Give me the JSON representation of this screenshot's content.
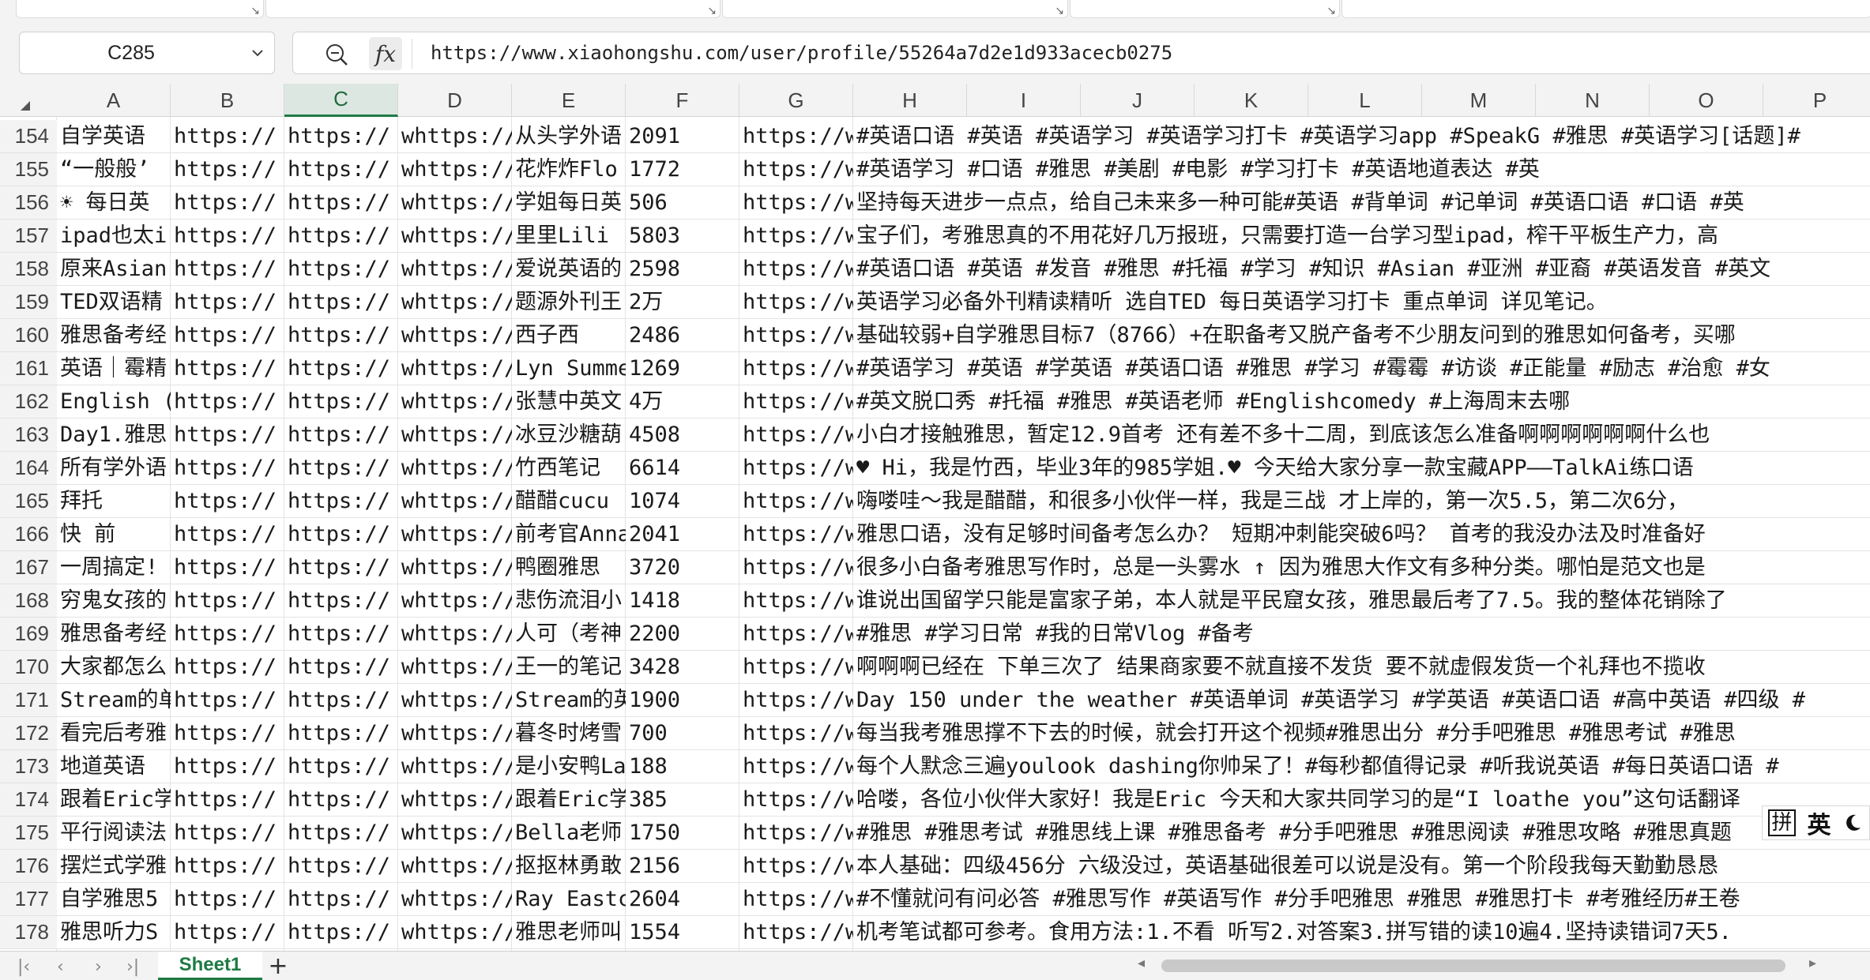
{
  "formula_bar": {
    "name_box": "C285",
    "fx_label": "fx",
    "formula_value": "https://www.xiaohongshu.com/user/profile/55264a7d2e1d933acecb0275"
  },
  "columns": [
    "A",
    "B",
    "C",
    "D",
    "E",
    "F",
    "G",
    "H",
    "I",
    "J",
    "K",
    "L",
    "M",
    "N",
    "O",
    "P"
  ],
  "selected_column": "C",
  "rows": [
    {
      "num": "154",
      "A": "自学英语",
      "B": "https://",
      "C": "https://",
      "D": "whttps://s",
      "E": "从头学外语",
      "F": "2091",
      "G": "https://w",
      "H": "#英语口语 #英语 #英语学习 #英语学习打卡 #英语学习app #SpeakG #雅思 #英语学习[话题]#"
    },
    {
      "num": "155",
      "A": "“一般般’",
      "B": "https://",
      "C": "https://",
      "D": "whttps://s",
      "E": "花炸炸Flo",
      "F": "1772",
      "G": "https://w",
      "H": "#英语学习  #口语  #雅思  #美剧  #电影  #学习打卡  #英语地道表达  #英"
    },
    {
      "num": "156",
      "A": "☀ 每日英",
      "B": "https://",
      "C": "https://",
      "D": "whttps://s",
      "E": "学姐每日英",
      "F": "506",
      "G": "https://w",
      "H": "坚持每天进步一点点，给自己未来多一种可能#英语 #背单词 #记单词 #英语口语 #口语 #英"
    },
    {
      "num": "157",
      "A": "ipad也太i",
      "B": "https://",
      "C": "https://",
      "D": "whttps://s",
      "E": "里里Lili",
      "F": "5803",
      "G": "https://w",
      "H": "宝子们，考雅思真的不用花好几万报班，只需要打造一台学习型ipad，榨干平板生产力，高"
    },
    {
      "num": "158",
      "A": "原来Asian",
      "B": "https://",
      "C": "https://",
      "D": "whttps://s",
      "E": "爱说英语的",
      "F": "2598",
      "G": "https://w",
      "H": "#英语口语 #英语 #发音 #雅思 #托福 #学习 #知识 #Asian #亚洲 #亚裔 #英语发音 #英文"
    },
    {
      "num": "159",
      "A": "TED双语精",
      "B": "https://",
      "C": "https://",
      "D": "whttps://s",
      "E": "题源外刊王",
      "F": "2万",
      "G": "https://w",
      "H": "  英语学习必备外刊精读精听  选自TED  每日英语学习打卡   重点单词   详见笔记。"
    },
    {
      "num": "160",
      "A": "雅思备考经",
      "B": "https://",
      "C": "https://",
      "D": "whttps://s",
      "E": "西子西",
      "F": "2486",
      "G": "https://w",
      "H": "基础较弱+自学雅思目标7（8766）+在职备考又脱产备考不少朋友问到的雅思如何备考，买哪"
    },
    {
      "num": "161",
      "A": "英语｜霉精",
      "B": "https://",
      "C": "https://",
      "D": "whttps://s",
      "E": "Lyn Summer",
      "F": "1269",
      "G": "https://w",
      "H": "#英语学习 #英语 #学英语 #英语口语 #雅思 #学习 #霉霉 #访谈 #正能量 #励志 #治愈 #女"
    },
    {
      "num": "162",
      "A": "English (",
      "B": "https://",
      "C": "https://",
      "D": "whttps://s",
      "E": "张慧中英文",
      "F": "4万",
      "G": "https://w",
      "H": "#英文脱口秀   #托福   #雅思   #英语老师   #Englishcomedy   #上海周末去哪"
    },
    {
      "num": "163",
      "A": "Day1.雅思",
      "B": "https://",
      "C": "https://",
      "D": "whttps://s",
      "E": "冰豆沙糖葫",
      "F": "4508",
      "G": "https://w",
      "H": "小白才接触雅思，暂定12.9首考  还有差不多十二周，到底该怎么准备啊啊啊啊啊啊什么也"
    },
    {
      "num": "164",
      "A": "所有学外语",
      "B": "https://",
      "C": "https://",
      "D": "whttps://s",
      "E": "竹西笔记",
      "F": "6614",
      "G": "https://w",
      "H": "♥  Hi，我是竹西，毕业3年的985学姐.♥  今天给大家分享一款宝藏APP——TalkAi练口语"
    },
    {
      "num": "165",
      "A": "  拜托",
      "B": "https://",
      "C": "https://",
      "D": "whttps://s",
      "E": "醋醋cucu",
      "F": "1074",
      "G": "https://w",
      "H": " 嗨喽哇～我是醋醋，和很多小伙伴一样，我是三战   才上岸的，第一次5.5，第二次6分，"
    },
    {
      "num": "166",
      "A": "快  前",
      "B": "https://",
      "C": "https://",
      "D": "whttps://s",
      "E": "前考官Anna",
      "F": "2041",
      "G": "https://w",
      "H": "雅思口语，没有足够时间备考怎么办？  短期冲刺能突破6吗？  首考的我没办法及时准备好"
    },
    {
      "num": "167",
      "A": "一周搞定!",
      "B": "https://",
      "C": "https://",
      "D": "whttps://s",
      "E": "鸭圈雅思",
      "F": "3720",
      "G": "https://w",
      "H": "很多小白备考雅思写作时，总是一头雾水 ↑  因为雅思大作文有多种分类。哪怕是范文也是"
    },
    {
      "num": "168",
      "A": "穷鬼女孩的",
      "B": "https://",
      "C": "https://",
      "D": "whttps://s",
      "E": "悲伤流泪小",
      "F": "1418",
      "G": "https://w",
      "H": "谁说出国留学只能是富家子弟，本人就是平民窟女孩，雅思最后考了7.5。我的整体花销除了"
    },
    {
      "num": "169",
      "A": "雅思备考经",
      "B": "https://",
      "C": "https://",
      "D": "whttps://s",
      "E": "人可（考神",
      "F": "2200",
      "G": "https://w",
      "H": "#雅思 #学习日常 #我的日常Vlog #备考"
    },
    {
      "num": "170",
      "A": "大家都怎么",
      "B": "https://",
      "C": "https://",
      "D": "whttps://s",
      "E": "王一的笔记",
      "F": "3428",
      "G": "https://w",
      "H": "啊啊啊已经在  下单三次了 结果商家要不就直接不发货 要不就虚假发货一个礼拜也不揽收"
    },
    {
      "num": "171",
      "A": "Stream的单",
      "B": "https://",
      "C": "https://",
      "D": "whttps://s",
      "E": "Stream的英",
      "F": "1900",
      "G": "https://w",
      "H": "Day 150 under the weather #英语单词 #英语学习 #学英语 #英语口语 #高中英语 #四级 #"
    },
    {
      "num": "172",
      "A": "看完后考雅",
      "B": "https://",
      "C": "https://",
      "D": "whttps://s",
      "E": "暮冬时烤雪",
      "F": "700",
      "G": "https://w",
      "H": "每当我考雅思撑不下去的时候，就会打开这个视频#雅思出分 #分手吧雅思 #雅思考试 #雅思"
    },
    {
      "num": "173",
      "A": "地道英语",
      "B": "https://",
      "C": "https://",
      "D": "whttps://s",
      "E": "是小安鸭La",
      "F": "188",
      "G": "https://w",
      "H": "每个人默念三遍youlook dashing你帅呆了！#每秒都值得记录 #听我说英语 #每日英语口语 #"
    },
    {
      "num": "174",
      "A": "跟着Eric学",
      "B": "https://",
      "C": "https://",
      "D": "whttps://s",
      "E": "跟着Eric学",
      "F": "385",
      "G": "https://w",
      "H": "哈喽，各位小伙伴大家好！我是Eric 今天和大家共同学习的是“I loathe you”这句话翻译"
    },
    {
      "num": "175",
      "A": "平行阅读法",
      "B": "https://",
      "C": "https://",
      "D": "whttps://s",
      "E": "Bella老师",
      "F": "1750",
      "G": "https://w",
      "H": "#雅思 #雅思考试 #雅思线上课 #雅思备考 #分手吧雅思 #雅思阅读 #雅思攻略 #雅思真题"
    },
    {
      "num": "176",
      "A": "摆烂式学雅",
      "B": "https://",
      "C": "https://",
      "D": "whttps://s",
      "E": "抠抠林勇敢",
      "F": "2156",
      "G": "https://w",
      "H": "本人基础：四级456分 六级没过，英语基础很差可以说是没有。第一个阶段我每天勤勤恳恳"
    },
    {
      "num": "177",
      "A": "自学雅思5",
      "B": "https://",
      "C": "https://",
      "D": "whttps://s",
      "E": "Ray Eastco",
      "F": "2604",
      "G": "https://w",
      "H": "#不懂就问有问必答 #雅思写作 #英语写作 #分手吧雅思 #雅思 #雅思打卡 #考雅经历#王卷"
    },
    {
      "num": "178",
      "A": "雅思听力S",
      "B": "https://",
      "C": "https://",
      "D": "whttps://s",
      "E": "雅思老师叫",
      "F": "1554",
      "G": "https://w",
      "H": "机考笔试都可参考。食用方法:1.不看  听写2.对答案3.拼写错的读10遍4.坚持读错词7天5."
    }
  ],
  "sheet_tabs": [
    "Sheet1"
  ],
  "add_sheet_label": "+",
  "ime": {
    "mode1": "拼",
    "mode2": "英"
  }
}
